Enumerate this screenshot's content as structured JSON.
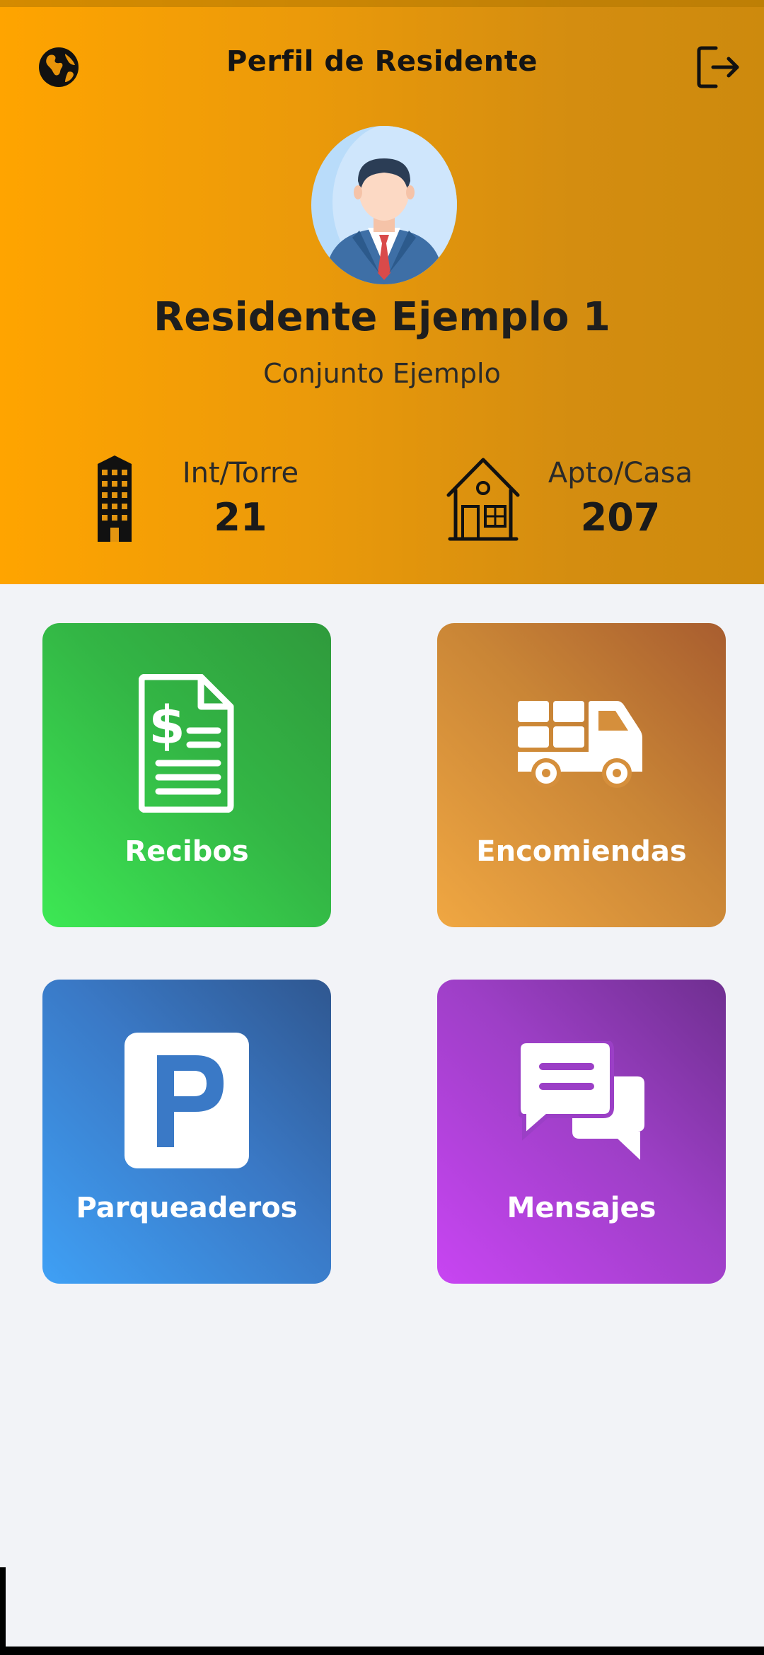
{
  "header": {
    "title": "Perfil de Residente",
    "left_icon": "globe-icon",
    "right_icon": "logout-icon",
    "background_start": "#ffa400",
    "background_end": "#cd8a0d"
  },
  "profile": {
    "name": "Residente Ejemplo 1",
    "complex": "Conjunto Ejemplo",
    "avatar_icon": "businessman-avatar"
  },
  "unit": {
    "tower_label": "Int/Torre",
    "tower_value": "21",
    "apartment_label": "Apto/Casa",
    "apartment_value": "207"
  },
  "tiles": [
    {
      "label": "Recibos",
      "icon": "receipt-dollar-icon",
      "color": "#33b645"
    },
    {
      "label": "Encomiendas",
      "icon": "delivery-truck-icon",
      "color": "#c98536"
    },
    {
      "label": "Parqueaderos",
      "icon": "parking-icon",
      "color": "#3a79c6"
    },
    {
      "label": "Mensajes",
      "icon": "chat-bubbles-icon",
      "color": "#9d3fc6"
    }
  ]
}
